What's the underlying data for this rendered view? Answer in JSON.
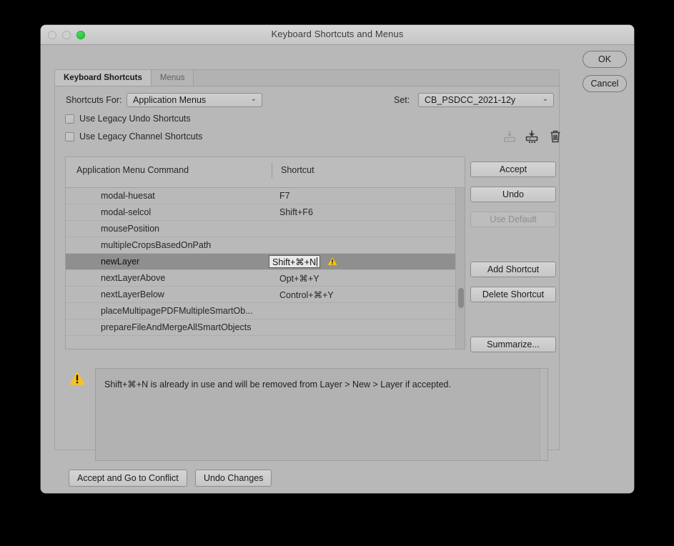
{
  "window": {
    "title": "Keyboard Shortcuts and Menus",
    "traffic_lights": {
      "close": "close-button",
      "minimize": "minimize-button",
      "zoom": "zoom-button"
    }
  },
  "dialog_buttons": {
    "ok": "OK",
    "cancel": "Cancel"
  },
  "tabs": [
    {
      "label": "Keyboard Shortcuts",
      "active": true
    },
    {
      "label": "Menus",
      "active": false
    }
  ],
  "shortcuts_for": {
    "label": "Shortcuts For:",
    "value": "Application Menus"
  },
  "set": {
    "label": "Set:",
    "value": "CB_PSDCC_2021-12y",
    "icons": [
      {
        "name": "save-set-icon",
        "enabled": false
      },
      {
        "name": "save-as-new-set-icon",
        "enabled": true
      },
      {
        "name": "delete-set-icon",
        "enabled": true
      }
    ]
  },
  "checkboxes": [
    {
      "label": "Use Legacy Undo Shortcuts",
      "checked": false
    },
    {
      "label": "Use Legacy Channel Shortcuts",
      "checked": false
    }
  ],
  "list": {
    "headers": {
      "command": "Application Menu Command",
      "shortcut": "Shortcut"
    },
    "rows": [
      {
        "command": "modal-huesat",
        "shortcut": "F7",
        "selected": false
      },
      {
        "command": "modal-selcol",
        "shortcut": "Shift+F6",
        "selected": false
      },
      {
        "command": "mousePosition",
        "shortcut": "",
        "selected": false
      },
      {
        "command": "multipleCropsBasedOnPath",
        "shortcut": "",
        "selected": false
      },
      {
        "command": "newLayer",
        "shortcut": "Shift+⌘+N",
        "selected": true,
        "editing": true,
        "warning": true
      },
      {
        "command": "nextLayerAbove",
        "shortcut": "Opt+⌘+Y",
        "selected": false
      },
      {
        "command": "nextLayerBelow",
        "shortcut": "Control+⌘+Y",
        "selected": false
      },
      {
        "command": "placeMultipagePDFMultipleSmartOb...",
        "shortcut": "",
        "selected": false
      },
      {
        "command": "prepareFileAndMergeAllSmartObjects",
        "shortcut": "",
        "selected": false
      }
    ]
  },
  "side_buttons": [
    {
      "label": "Accept",
      "enabled": true
    },
    {
      "label": "Undo",
      "enabled": true
    },
    {
      "label": "Use Default",
      "enabled": false
    },
    {
      "label": "Add Shortcut",
      "enabled": true
    },
    {
      "label": "Delete Shortcut",
      "enabled": true
    },
    {
      "label": "Summarize...",
      "enabled": true
    }
  ],
  "message": {
    "icon": "warning-icon",
    "text": "Shift+⌘+N is already in use and will be removed from Layer > New > Layer if accepted."
  },
  "bottom_buttons": {
    "accept_conflict": "Accept and Go to Conflict",
    "undo_changes": "Undo Changes"
  },
  "colors": {
    "window_bg": "#b8b8b8",
    "titlebar": "#cecece",
    "selected_row": "#8f8f8f",
    "warning_yellow": "#fcc21b",
    "zoom_green": "#28c840"
  }
}
